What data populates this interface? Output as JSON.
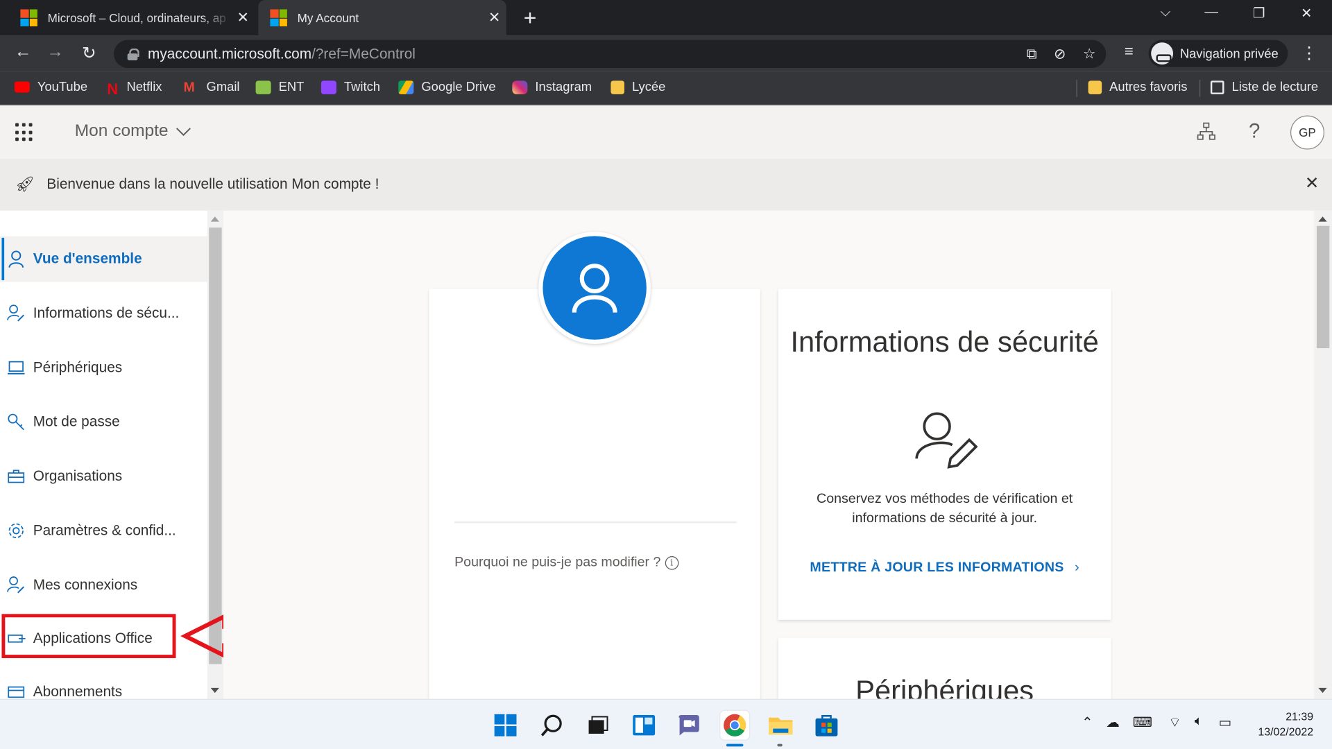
{
  "browser": {
    "tabs": [
      {
        "title": "Microsoft – Cloud, ordinateurs, ap",
        "active": false
      },
      {
        "title": "My Account",
        "active": true
      }
    ],
    "url_host": "myaccount.microsoft.com",
    "url_path": "/?ref=MeControl",
    "private_label": "Navigation privée",
    "bookmarks": [
      {
        "label": "YouTube",
        "icon": "youtube-icon",
        "color": "#ff0000"
      },
      {
        "label": "Netflix",
        "icon": "netflix-icon",
        "color": "#e50914"
      },
      {
        "label": "Gmail",
        "icon": "gmail-icon",
        "color": "#ea4335"
      },
      {
        "label": "ENT",
        "icon": "ent-icon",
        "color": "#8bc34a"
      },
      {
        "label": "Twitch",
        "icon": "twitch-icon",
        "color": "#9146ff"
      },
      {
        "label": "Google Drive",
        "icon": "google-drive-icon",
        "color": "#fbbc04"
      },
      {
        "label": "Instagram",
        "icon": "instagram-icon",
        "color": "#d62976"
      },
      {
        "label": "Lycée",
        "icon": "folder-icon",
        "color": "#f6c74a"
      }
    ],
    "other_bookmarks": "Autres favoris",
    "reading_list": "Liste de lecture"
  },
  "header": {
    "app_name": "Mon compte",
    "avatar_initials": "GP"
  },
  "banner": {
    "message": "Bienvenue dans la nouvelle utilisation Mon compte !"
  },
  "nav": {
    "items": [
      {
        "label": "Vue d'ensemble",
        "icon": "person-icon",
        "active": true
      },
      {
        "label": "Informations de sécu...",
        "icon": "person-key-icon",
        "active": false
      },
      {
        "label": "Périphériques",
        "icon": "laptop-icon",
        "active": false
      },
      {
        "label": "Mot de passe",
        "icon": "key-icon",
        "active": false
      },
      {
        "label": "Organisations",
        "icon": "briefcase-icon",
        "active": false
      },
      {
        "label": "Paramètres & confid...",
        "icon": "gear-icon",
        "active": false
      },
      {
        "label": "Mes connexions",
        "icon": "person-key-icon",
        "active": false
      },
      {
        "label": "Applications Office",
        "icon": "app-icon",
        "active": false,
        "highlighted": true
      },
      {
        "label": "Abonnements",
        "icon": "card-icon",
        "active": false
      }
    ]
  },
  "profile_card": {
    "why_text": "Pourquoi ne puis-je pas modifier ?"
  },
  "security_card": {
    "title": "Informations de sécurité",
    "description": "Conservez vos méthodes de vérification et informations de sécurité à jour.",
    "link": "METTRE À JOUR LES INFORMATIONS"
  },
  "devices_card": {
    "title": "Périphériques"
  },
  "taskbar": {
    "time": "21:39",
    "date": "13/02/2022"
  },
  "colors": {
    "accent": "#0f6cbd",
    "highlight_red": "#e3141b"
  }
}
